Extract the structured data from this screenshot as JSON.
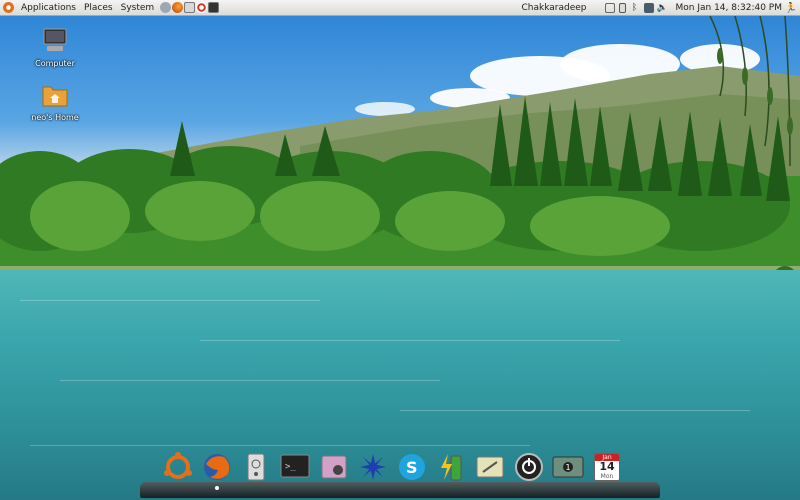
{
  "panel": {
    "menus": [
      "Applications",
      "Places",
      "System"
    ],
    "launchers": [
      "help-icon",
      "firefox-icon",
      "evolution-icon",
      "lifesaver-icon",
      "terminal-icon"
    ],
    "tray": [
      "network-icon",
      "battery-icon",
      "bluetooth-icon",
      "display-icon",
      "volume-icon"
    ],
    "user": "Chakkaradeep",
    "clock": "Mon Jan 14,  8:32:40 PM"
  },
  "desktop": {
    "icons": [
      {
        "label": "Computer",
        "icon": "computer-icon"
      },
      {
        "label": "neo's Home",
        "icon": "home-folder-icon"
      }
    ]
  },
  "dock": {
    "items": [
      {
        "name": "ubuntu",
        "icon": "ubuntu-logo-icon"
      },
      {
        "name": "firefox",
        "icon": "firefox-icon",
        "running": true
      },
      {
        "name": "drive",
        "icon": "hard-drive-icon"
      },
      {
        "name": "terminal",
        "icon": "terminal-icon"
      },
      {
        "name": "screenshot",
        "icon": "screenshot-icon"
      },
      {
        "name": "pinwheel",
        "icon": "pinwheel-icon"
      },
      {
        "name": "skype",
        "icon": "skype-icon"
      },
      {
        "name": "battery",
        "icon": "battery-icon"
      },
      {
        "name": "notes",
        "icon": "notes-icon"
      },
      {
        "name": "power",
        "icon": "power-icon"
      },
      {
        "name": "workspace",
        "icon": "workspace-switcher-icon"
      },
      {
        "name": "calendar",
        "icon": "calendar-icon",
        "month": "Jan",
        "day": "14",
        "weekday": "Mon"
      }
    ]
  },
  "colors": {
    "panel": "#dcdbd6",
    "sky": "#2f86d6",
    "water": "#3aa6ad",
    "forest": "#3f8e2c"
  }
}
